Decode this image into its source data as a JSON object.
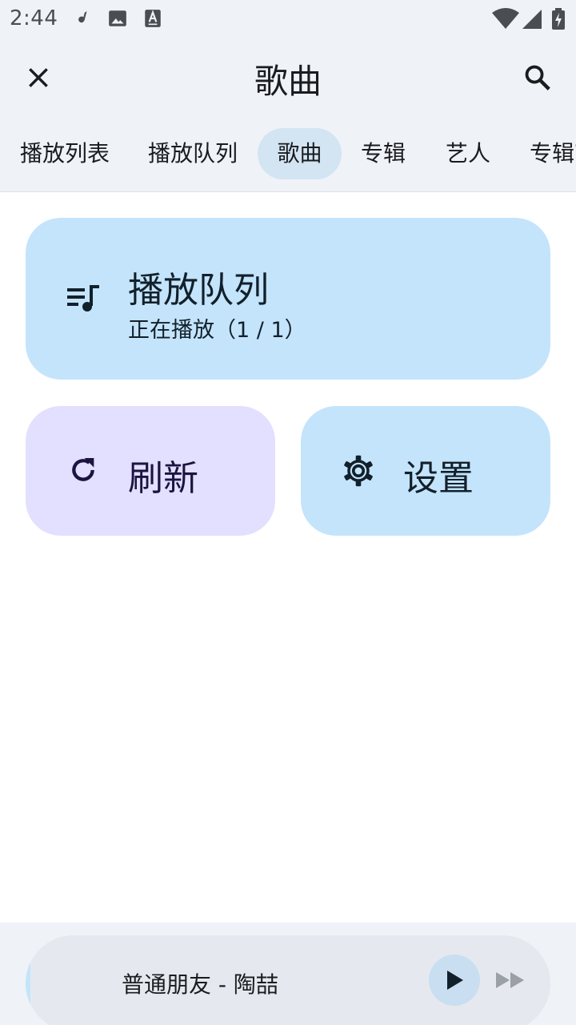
{
  "status_bar": {
    "time": "2:44",
    "left_icons": [
      "music-note-icon",
      "image-icon",
      "text-a-icon"
    ],
    "right_icons": [
      "wifi-icon",
      "signal-icon",
      "battery-charging-icon"
    ]
  },
  "appbar": {
    "title": "歌曲",
    "close_icon": "close-icon",
    "search_icon": "search-icon"
  },
  "tabs": [
    {
      "label": "播放列表",
      "active": false
    },
    {
      "label": "播放队列",
      "active": false
    },
    {
      "label": "歌曲",
      "active": true
    },
    {
      "label": "专辑",
      "active": false
    },
    {
      "label": "艺人",
      "active": false
    },
    {
      "label": "专辑艺",
      "active": false
    }
  ],
  "cards": {
    "queue": {
      "icon": "queue-music-icon",
      "title": "播放队列",
      "subtitle": "正在播放（1 / 1）",
      "color": "#c4e4fb"
    },
    "refresh": {
      "icon": "refresh-icon",
      "label": "刷新",
      "color": "#e3dfff"
    },
    "settings": {
      "icon": "gear-icon",
      "label": "设置",
      "color": "#c4e4fb"
    }
  },
  "player": {
    "now_playing": "普通朋友 - 陶喆",
    "play_icon": "play-icon",
    "next_icon": "skip-next-icon"
  },
  "colors": {
    "surface": "#eff2f7",
    "tab_active": "#d3e4f3",
    "primary_container": "#c4e4fb",
    "tertiary_container": "#e3dfff"
  }
}
